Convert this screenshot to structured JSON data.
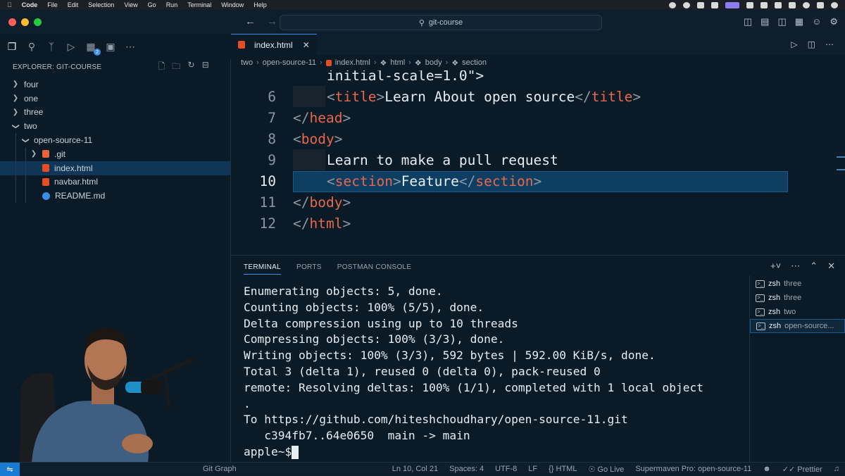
{
  "menubar": {
    "app": "Code",
    "items": [
      "File",
      "Edit",
      "Selection",
      "View",
      "Go",
      "Run",
      "Terminal",
      "Window",
      "Help"
    ]
  },
  "titlebar": {
    "search": "git-course"
  },
  "activity": {
    "extensions_badge": "2"
  },
  "explorer": {
    "title": "EXPLORER: GIT-COURSE",
    "items": [
      {
        "label": "four"
      },
      {
        "label": "one"
      },
      {
        "label": "three"
      },
      {
        "label": "two"
      },
      {
        "label": "open-source-11"
      },
      {
        "label": ".git"
      },
      {
        "label": "index.html"
      },
      {
        "label": "navbar.html"
      },
      {
        "label": "README.md"
      }
    ]
  },
  "editor": {
    "tab_label": "index.html",
    "breadcrumb": [
      "two",
      "open-source-11",
      "index.html",
      "html",
      "body",
      "section"
    ],
    "line5_text": "initial-scale=1.0\">",
    "lines": [
      {
        "num": "6",
        "before": "<",
        "tag": "title",
        "mid": ">Learn About open source</",
        "tag2": "title",
        "after": ">"
      },
      {
        "num": "7"
      },
      {
        "num": "8"
      },
      {
        "num": "9"
      },
      {
        "num": "10"
      },
      {
        "num": "11"
      },
      {
        "num": "12"
      }
    ],
    "l6_text": "Learn About open source",
    "l7_tag": "head",
    "l8_tag": "body",
    "l9_text": "Learn to make a pull request",
    "l10_tag": "section",
    "l10_text": "Feature",
    "l11_tag": "body",
    "l12_tag": "html",
    "title_tag": "title"
  },
  "panel": {
    "tabs": [
      "TERMINAL",
      "PORTS",
      "POSTMAN CONSOLE"
    ],
    "terminal_lines": [
      "Enumerating objects: 5, done.",
      "Counting objects: 100% (5/5), done.",
      "Delta compression using up to 10 threads",
      "Compressing objects: 100% (3/3), done.",
      "Writing objects: 100% (3/3), 592 bytes | 592.00 KiB/s, done.",
      "Total 3 (delta 1), reused 0 (delta 0), pack-reused 0",
      "remote: Resolving deltas: 100% (1/1), completed with 1 local object",
      ".",
      "To https://github.com/hiteshchoudhary/open-source-11.git",
      "   c394fb7..64e0650  main -> main"
    ],
    "prompt": "apple~$",
    "terminals": [
      {
        "name": "zsh",
        "sub": "three"
      },
      {
        "name": "zsh",
        "sub": "three"
      },
      {
        "name": "zsh",
        "sub": "two"
      },
      {
        "name": "zsh",
        "sub": "open-source..."
      }
    ]
  },
  "statusbar": {
    "git_graph": "Git Graph",
    "position": "Ln 10, Col 21",
    "spaces": "Spaces: 4",
    "encoding": "UTF-8",
    "eol": "LF",
    "language": "HTML",
    "go_live": "Go Live",
    "supermaven": "Supermaven Pro: open-source-11",
    "prettier": "Prettier"
  },
  "colors": {
    "accent": "#3a8ee6",
    "tag": "#e8684a",
    "background": "#0b1a27",
    "selected_row": "#0f3656"
  }
}
